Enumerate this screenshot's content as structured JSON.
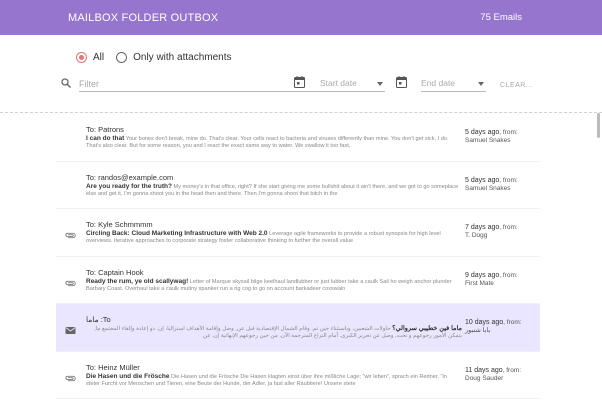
{
  "header": {
    "title": "MAILBOX FOLDER OUTBOX",
    "count": "75 Emails",
    "color": "#9575cd"
  },
  "filters": {
    "radio_all": "All",
    "radio_attachments": "Only with attachments",
    "selected": "All",
    "filter_placeholder": "Filter",
    "start_date_placeholder": "Start date",
    "end_date_placeholder": "End date",
    "clear_label": "CLEAR..."
  },
  "icons": {
    "search": "search-icon",
    "calendar": "calendar-icon",
    "attachment": "paperclip-icon",
    "mail": "envelope-icon"
  },
  "emails": [
    {
      "to": "To: Patrons",
      "subject": "I can do that",
      "preview": "Your bones don't break, mine do. That's clear. Your cells react to bacteria and viruses differently than mine. You don't get sick, I do. That's also clear. But for some reason, you and I react the exact same way to water. We swallow it too fast,",
      "days": "5 days ago",
      "from_label": ", from:",
      "from": "Samuel Snakes",
      "icon": "",
      "highlighted": false
    },
    {
      "to": "To: randos@example.com",
      "subject": "Are you ready for the truth?",
      "preview": "My money's in that office, right? If she start giving me some bullshit about it ain't there, and we got to go someplace else and get it, I'm gonna shoot you in the head then and there. Then I'm gonna shoot that bitch in the",
      "days": "5 days ago",
      "from_label": ", from:",
      "from": "Samuel Snakes",
      "icon": "",
      "highlighted": false
    },
    {
      "to": "To: Kyle Schmmmm",
      "subject": "Circling Back: Cloud Marketing Infrastructure with Web 2.0",
      "preview": "Leverage agile frameworks to provide a robust synopsis for high level overviews. Iterative approaches to corporate strategy foster collaborative thinking to further the overall value",
      "days": "7 days ago",
      "from_label": ", from:",
      "from": "T. Dogg",
      "icon": "paperclip",
      "highlighted": false
    },
    {
      "to": "To: Captain Hook",
      "subject": "Ready the rum, ye old scallywag!",
      "preview": "Letter of Marque skysail bilge keelhaul landlubber or just lubber take a caulk Sail ho weigh anchor plunder Barbary Coast. Overhaul take a caulk mutiny spanker run a rig cog to go on account barkadeer coxswain",
      "days": "9 days ago",
      "from_label": ", from:",
      "from": "First Mate",
      "icon": "paperclip",
      "highlighted": false
    },
    {
      "to": "To: ماما",
      "subject": "ماما فين خطيبي سروالي؟",
      "preview": "حاولات الشعبين، وباستثناء حين تم. وقام الشمال الإقتصادية قبل عن, وصل وإقامة الأهداف استراليا، إن. ذو إعادة وإلقاء المجتمع ما, يتمكن الأمور رجوعهم و تحت, وصل عن تحرير الكبرى. أمام النزاع المترجمة الآن, من حين رجوعهم الإنهائية إن, عن",
      "days": "10 days ago",
      "from_label": ", from:",
      "from": "بابا شنبور",
      "icon": "envelope",
      "highlighted": true
    },
    {
      "to": "To: Heinz Müller",
      "subject": "Die Hasen und die Frösche",
      "preview": "Die Hasen und die Frösche Die Hasen klagten einst über ihre mißliche Lage; \"wir leben\", sprach ein Redner, \"in steter Furcht vor Menschen und Tieren, eine Beute der Hunde, der Adler, ja fast aller Raubtiere! Unsere stete",
      "days": "11 days ago",
      "from_label": ", from:",
      "from": "Doug Sauder",
      "icon": "paperclip",
      "highlighted": false
    }
  ]
}
